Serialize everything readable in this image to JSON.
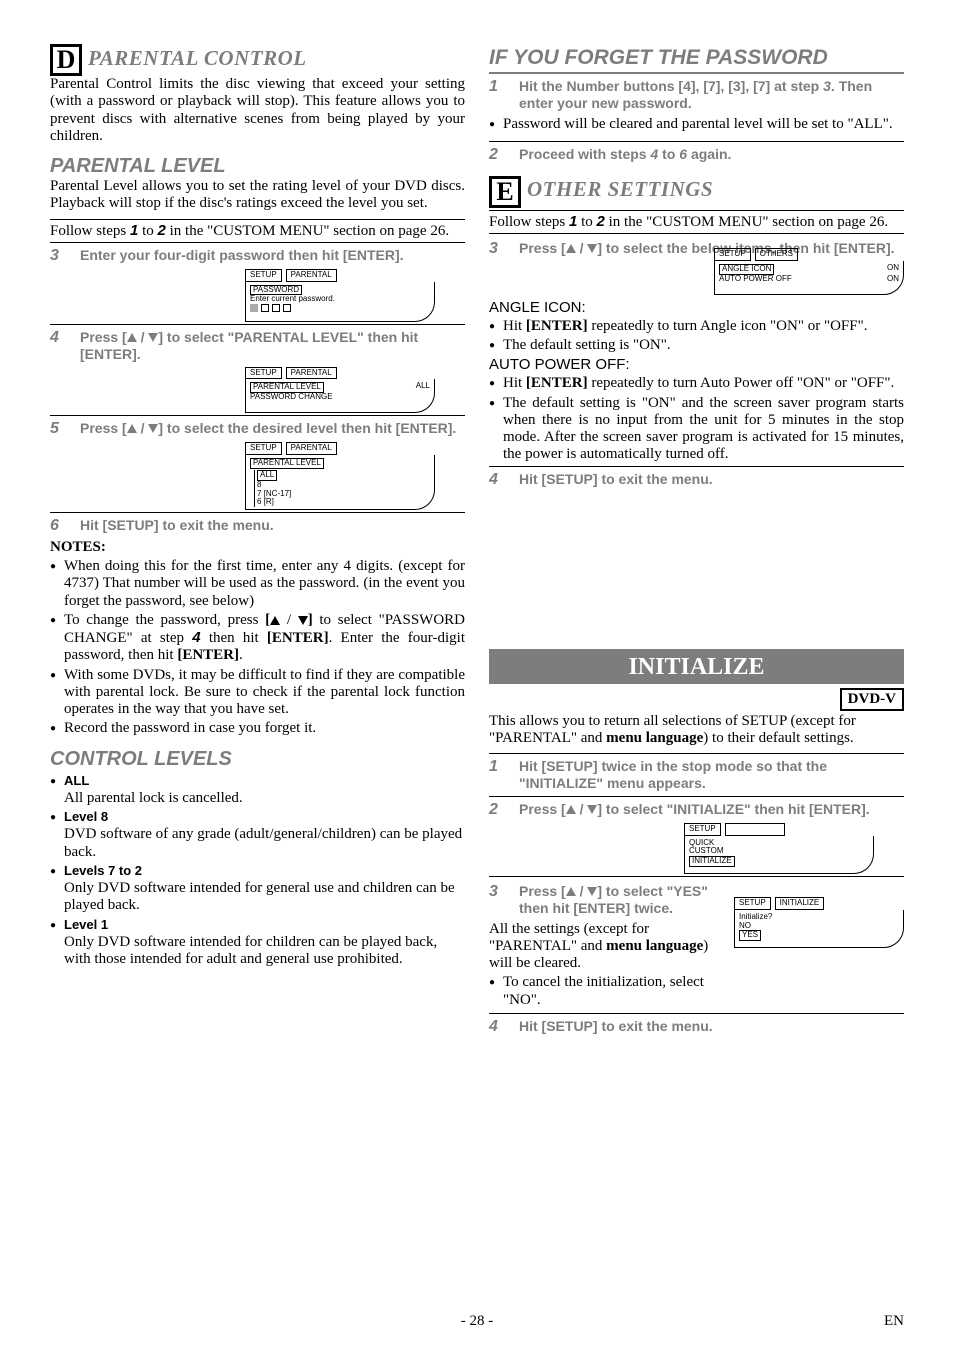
{
  "left": {
    "letter": "D",
    "section_title": "PARENTAL CONTROL",
    "intro": "Parental Control limits the disc viewing that exceed your setting (with a password or playback will stop). This feature allows you to prevent discs with alternative scenes from being played by your children.",
    "parental_level_heading": "PARENTAL LEVEL",
    "parental_level_body": "Parental Level allows you to set the rating level of your DVD discs. Playback will stop if the disc's ratings exceed the level you set.",
    "follow": "Follow steps ",
    "follow_1": "1",
    "follow_to": " to ",
    "follow_2": "2",
    "follow_end": " in the \"CUSTOM MENU\" section on page 26.",
    "step3": "Enter your four-digit password then hit [ENTER].",
    "osd1": {
      "tab1": "SETUP",
      "tab2": "PARENTAL",
      "line1": "PASSWORD",
      "line2": "Enter current password."
    },
    "step4_pre": "Press [",
    "step4_mid": " / ",
    "step4_post": "] to select \"PARENTAL LEVEL\" then hit [ENTER].",
    "osd2": {
      "tab1": "SETUP",
      "tab2": "PARENTAL",
      "line1": "PARENTAL LEVEL",
      "line1_right": "ALL",
      "line2": "PASSWORD CHANGE"
    },
    "step5_pre": "Press [",
    "step5_mid": " / ",
    "step5_post": "] to select the desired level then hit [ENTER].",
    "osd3": {
      "tab1": "SETUP",
      "tab2": "PARENTAL",
      "line1": "PARENTAL LEVEL",
      "line_all": "ALL",
      "line_8": "8",
      "line_7": "7 [NC-17]",
      "line_6": "6 [R]"
    },
    "step6": "Hit [SETUP] to exit the menu.",
    "notes_heading": "NOTES:",
    "note1": "When doing this for the first time, enter any 4 digits. (except for 4737) That number will be used as the password. (in the event you forget the password, see below)",
    "note2_pre": "To change the password, press ",
    "note2_br": "[",
    "note2_mid": " / ",
    "note2_br2": "]",
    "note2_post": " to select \"PASSWORD CHANGE\" at step ",
    "note2_step": "4",
    "note2_end": " then hit ",
    "note2_enter": "[ENTER]",
    "note2_tail": ". Enter the four-digit password, then hit ",
    "note2_enter2": "[ENTER]",
    "note2_period": ".",
    "note3": "With some DVDs, it may be difficult to find if they are compatible with parental lock. Be sure to check if the parental lock function operates in the way that you have set.",
    "note4": "Record the password in case you forget it.",
    "control_levels_heading": "CONTROL LEVELS",
    "cl_all_h": "ALL",
    "cl_all_b": "All parental lock is cancelled.",
    "cl_8_h": "Level 8",
    "cl_8_b": "DVD software of any grade (adult/general/children) can be played back.",
    "cl_72_h": "Levels 7 to 2",
    "cl_72_b": "Only DVD software intended for general use and children can be played back.",
    "cl_1_h": "Level 1",
    "cl_1_b": "Only DVD software intended for children can be played back, with those intended for adult and general use prohibited."
  },
  "right": {
    "forget_heading": "IF YOU FORGET THE PASSWORD",
    "step1_a": "Hit the Number buttons [4], [7], [3], [7] at step ",
    "step1_step": "3",
    "step1_b": ". Then enter your new password.",
    "bullet_pw": "Password will be cleared and parental level will be set to \"ALL\".",
    "step2_a": "Proceed with steps ",
    "step2_4": "4",
    "step2_to": " to ",
    "step2_6": "6",
    "step2_b": " again.",
    "letter": "E",
    "section_title": "OTHER SETTINGS",
    "follow": "Follow steps ",
    "follow_1": "1",
    "follow_to": " to ",
    "follow_2": "2",
    "follow_end": " in the \"CUSTOM MENU\" section on page 26.",
    "step3_pre": "Press [",
    "step3_mid": " / ",
    "step3_post": "] to select the below items, then hit [ENTER].",
    "osd4": {
      "tab1": "SETUP",
      "tab2": "OTHERS",
      "line1": "ANGLE ICON",
      "line1_v": "ON",
      "line2": "AUTO POWER OFF",
      "line2_v": "ON"
    },
    "angle_icon_head": "ANGLE ICON:",
    "angle_b1_a": "Hit ",
    "angle_b1_enter": "[ENTER]",
    "angle_b1_b": " repeatedly to turn Angle icon \"ON\" or \"OFF\".",
    "angle_b2": "The default setting is \"ON\".",
    "apo_head": "AUTO POWER OFF:",
    "apo_b1_a": "Hit ",
    "apo_b1_enter": "[ENTER]",
    "apo_b1_b": " repeatedly to turn Auto Power off \"ON\" or \"OFF\".",
    "apo_b2": "The default setting is \"ON\" and the screen saver program starts when there is no input from the unit for 5 minutes in the stop mode. After the screen saver program is activated for 15 minutes, the power is automatically turned off.",
    "step4": "Hit [SETUP] to exit the menu.",
    "initialize_banner": "INITIALIZE",
    "dvdv": "DVD-V",
    "init_intro_a": "This allows you to return all selections of SETUP (except for \"PARENTAL\" and ",
    "init_intro_menu": "menu language",
    "init_intro_b": ") to their default settings.",
    "istep1": "Hit [SETUP] twice in the stop mode so that the \"INITIALIZE\" menu appears.",
    "istep2_pre": "Press [",
    "istep2_mid": " / ",
    "istep2_post": "] to select \"INITIALIZE\" then hit [ENTER].",
    "osd5": {
      "tab1": "SETUP",
      "line1": "QUICK",
      "line2": "CUSTOM",
      "line3": "INITIALIZE"
    },
    "istep3_pre": "Press [",
    "istep3_mid": " / ",
    "istep3_post": "] to select \"YES\" then hit [ENTER] twice.",
    "istep3_body_a": "All the settings (except for \"PARENTAL\" and ",
    "istep3_body_menu": "menu language",
    "istep3_body_b": ") will be cleared.",
    "istep3_cancel": "To cancel the initialization, select \"NO\".",
    "osd6": {
      "tab1": "SETUP",
      "tab2": "INITIALIZE",
      "q": "Initialize?",
      "no": "NO",
      "yes": "YES"
    },
    "istep4": "Hit [SETUP] to exit the menu."
  },
  "footer": {
    "page": "- 28 -",
    "lang": "EN"
  }
}
